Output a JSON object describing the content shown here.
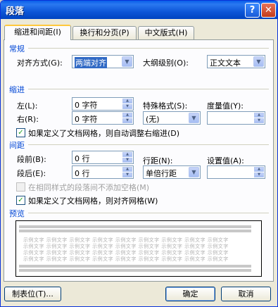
{
  "window": {
    "title": "段落",
    "help_glyph": "?",
    "close_glyph": "✕"
  },
  "tabs": [
    {
      "label": "缩进和间距(I)"
    },
    {
      "label": "换行和分页(P)"
    },
    {
      "label": "中文版式(H)"
    }
  ],
  "general": {
    "heading": "常规",
    "align_label": "对齐方式(G):",
    "align_value": "两端对齐",
    "outline_label": "大纲级别(O):",
    "outline_value": "正文文本"
  },
  "indent": {
    "heading": "缩进",
    "left_label": "左(L):",
    "left_value": "0 字符",
    "right_label": "右(R):",
    "right_value": "0 字符",
    "special_label": "特殊格式(S):",
    "special_value": "(无)",
    "by_label": "度量值(Y):",
    "by_value": "",
    "grid_check_label": "如果定义了文档网格，则自动调整右缩进(D)",
    "grid_checked": true
  },
  "spacing": {
    "heading": "间距",
    "before_label": "段前(B):",
    "before_value": "0 行",
    "after_label": "段后(E):",
    "after_value": "0 行",
    "line_label": "行距(N):",
    "line_value": "单倍行距",
    "at_label": "设置值(A):",
    "at_value": "",
    "no_space_label": "在相同样式的段落间不添加空格(M)",
    "no_space_checked": false,
    "snap_label": "如果定义了文档网格，则对齐网格(W)",
    "snap_checked": true
  },
  "preview": {
    "heading": "预览",
    "sample_line": "示例文字 示例文字 示例文字 示例文字 示例文字 示例文字 示例文字 示例文字 示例文字"
  },
  "buttons": {
    "tabs_label": "制表位(T)...",
    "ok_label": "确定",
    "cancel_label": "取消"
  },
  "colors": {
    "section_heading": "#0046d5",
    "titlebar": "#0a5fea",
    "accent": "#316ac5"
  }
}
